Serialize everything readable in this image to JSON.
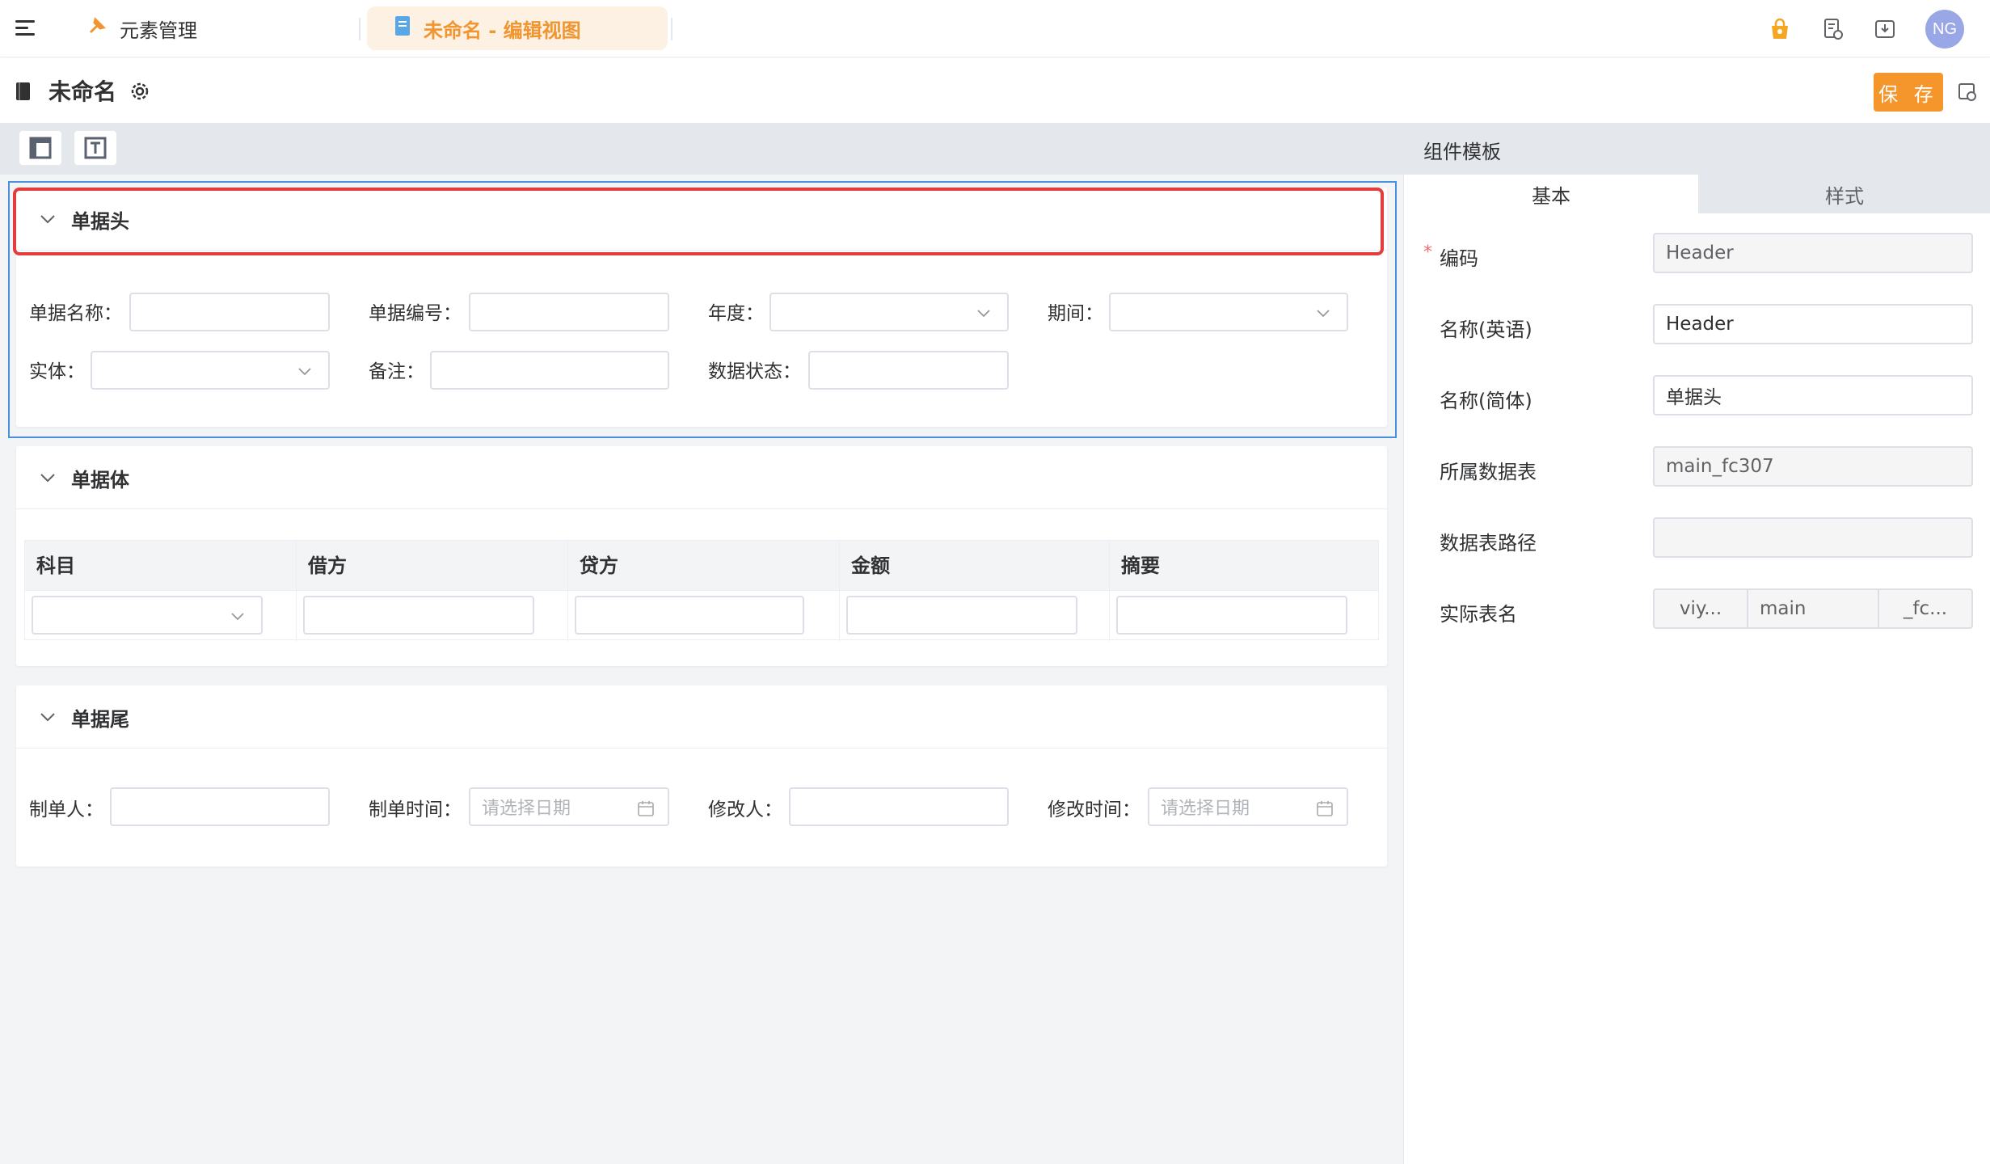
{
  "topbar": {
    "tabs": [
      {
        "label": "元素管理",
        "icon": "pin-icon"
      },
      {
        "label": "未命名 - 编辑视图",
        "icon": "document-icon"
      }
    ],
    "avatar_text": "NG",
    "accent": "#f5962d"
  },
  "titlebar": {
    "title": "未命名",
    "save_label": "保 存"
  },
  "sections": {
    "header": {
      "title": "单据头",
      "fields": {
        "doc_name": "单据名称：",
        "doc_no": "单据编号：",
        "year": "年度：",
        "period": "期间：",
        "entity": "实体：",
        "remark": "备注：",
        "status": "数据状态："
      }
    },
    "body": {
      "title": "单据体",
      "columns": [
        "科目",
        "借方",
        "贷方",
        "金额",
        "摘要"
      ]
    },
    "footer": {
      "title": "单据尾",
      "fields": {
        "creator": "制单人：",
        "create_time": "制单时间：",
        "modifier": "修改人：",
        "modify_time": "修改时间："
      },
      "date_placeholder": "请选择日期"
    }
  },
  "panel": {
    "title": "组件模板",
    "tabs": [
      "基本",
      "样式"
    ],
    "props": {
      "code_label": "编码",
      "code_value": "Header",
      "name_en_label": "名称(英语)",
      "name_en_value": "Header",
      "name_zh_label": "名称(简体)",
      "name_zh_value": "单据头",
      "table_label": "所属数据表",
      "table_value": "main_fc307",
      "path_label": "数据表路径",
      "path_value": "",
      "real_label": "实际表名",
      "real_parts": [
        "viy...",
        "main",
        "_fc..."
      ]
    }
  }
}
